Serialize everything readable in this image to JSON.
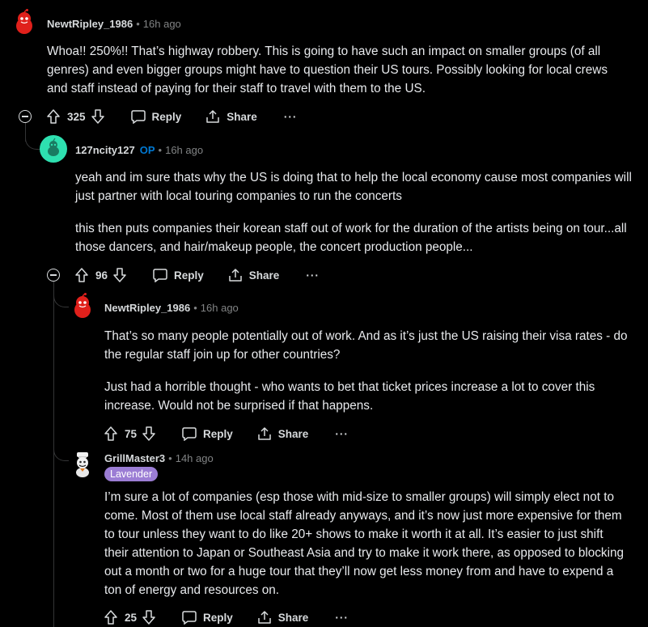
{
  "comments": [
    {
      "author": "NewtRipley_1986",
      "time": "16h ago",
      "paragraphs": [
        "Whoa!! 250%!! That’s highway robbery. This is going to have such an impact on smaller groups (of all genres) and even bigger groups might have to question their US tours. Possibly looking for local crews and staff instead of paying for their staff to travel with them to the US."
      ],
      "score": "325",
      "reply_label": "Reply",
      "share_label": "Share",
      "more_label": "···"
    },
    {
      "author": "127ncity127",
      "op_badge": "OP",
      "time": "16h ago",
      "paragraphs": [
        "yeah and im sure thats why the US is doing that to help the local economy cause most companies will just partner with local touring companies to run the concerts",
        "this then puts companies their korean staff out of work for the duration of the artists being on tour...all those dancers, and hair/makeup people, the concert production people..."
      ],
      "score": "96",
      "reply_label": "Reply",
      "share_label": "Share",
      "more_label": "···"
    },
    {
      "author": "NewtRipley_1986",
      "time": "16h ago",
      "paragraphs": [
        "That’s so many people potentially out of work. And as it’s just the US raising their visa rates - do the regular staff join up for other countries?",
        "Just had a horrible thought - who wants to bet that ticket prices increase a lot to cover this increase. Would not be surprised if that happens."
      ],
      "score": "75",
      "reply_label": "Reply",
      "share_label": "Share",
      "more_label": "···"
    },
    {
      "author": "GrillMaster3",
      "flair": "Lavender",
      "time": "14h ago",
      "paragraphs": [
        "I’m sure a lot of companies (esp those with mid-size to smaller groups) will simply elect not to come. Most of them use local staff already anyways, and it’s now just more expensive for them to tour unless they want to do like 20+ shows to make it worth it at all. It’s easier to just shift their attention to Japan or Southeast Asia and try to make it work there, as opposed to blocking out a month or two for a huge tour that they’ll now get less money from and have to expend a ton of energy and resources on."
      ],
      "score": "25",
      "reply_label": "Reply",
      "share_label": "Share",
      "more_label": "···"
    }
  ],
  "colors": {
    "background": "#000000",
    "text": "#d7dadc",
    "muted": "#818384",
    "op_blue": "#0079d3",
    "flair_purple": "#9b7dd4",
    "avatar_red": "#ff4500"
  }
}
